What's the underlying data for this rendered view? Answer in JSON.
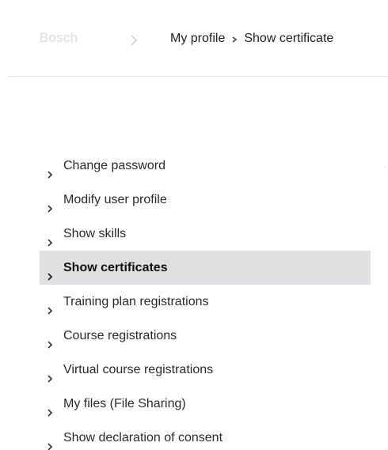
{
  "header": {
    "logo_text": "Bosch",
    "breadcrumb": {
      "parent": "My profile",
      "current": "Show certificate"
    }
  },
  "menu": {
    "items": [
      {
        "label": "Change password",
        "active": false
      },
      {
        "label": "Modify user profile",
        "active": false
      },
      {
        "label": "Show skills",
        "active": false
      },
      {
        "label": "Show certificates",
        "active": true
      },
      {
        "label": "Training plan registrations",
        "active": false
      },
      {
        "label": "Course registrations",
        "active": false
      },
      {
        "label": "Virtual course registrations",
        "active": false
      },
      {
        "label": "My files (File Sharing)",
        "active": false
      },
      {
        "label": "Show declaration of consent",
        "active": false
      }
    ]
  },
  "colors": {
    "active_background": "#dfe0e1",
    "logo_text": "#d9dbdd",
    "divider": "#e3e5e7"
  },
  "icons": {
    "menu_item": "chevron-right-icon",
    "header_separator": "chevron-right-icon",
    "breadcrumb_separator": "chevron-right-icon"
  }
}
